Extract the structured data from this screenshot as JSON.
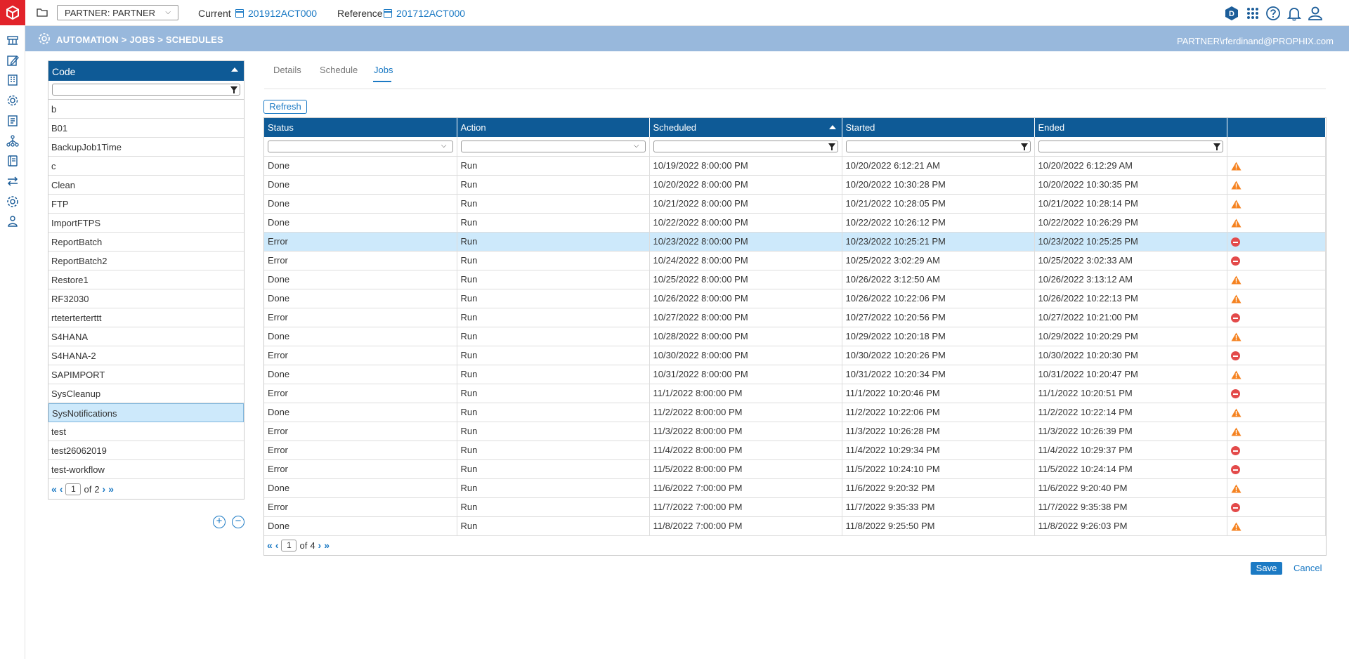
{
  "topbar": {
    "partner_select": "PARTNER: PARTNER",
    "current_label": "Current",
    "current_value": "201912ACT000",
    "reference_label": "Reference",
    "reference_value": "201712ACT000",
    "avatar_letter": "D",
    "icons": [
      "folder-icon",
      "apps-grid-icon",
      "help-icon",
      "bell-icon",
      "user-icon"
    ]
  },
  "rail": {
    "icons": [
      "logo-icon",
      "workflow-icon",
      "edit-document-icon",
      "org-chart-icon",
      "settings-gear-icon",
      "report-icon",
      "hierarchy-icon",
      "book-icon",
      "transfer-icon",
      "automation-gear-icon",
      "users-icon"
    ]
  },
  "breadcrumb": {
    "path": "AUTOMATION > JOBS > SCHEDULES",
    "user": "PARTNER\\rferdinand@PROPHIX.com"
  },
  "code_list": {
    "header": "Code",
    "items": [
      "b",
      "B01",
      "BackupJob1Time",
      "c",
      "Clean",
      "FTP",
      "ImportFTPS",
      "ReportBatch",
      "ReportBatch2",
      "Restore1",
      "RF32030",
      "rteterterterttt",
      "S4HANA",
      "S4HANA-2",
      "SAPIMPORT",
      "SysCleanup",
      "SysNotifications",
      "test",
      "test26062019",
      "test-workflow"
    ],
    "selected": "SysNotifications",
    "page": "1",
    "of_label": "of",
    "total_pages": "2"
  },
  "tabs": [
    {
      "label": "Details",
      "active": false
    },
    {
      "label": "Schedule",
      "active": false
    },
    {
      "label": "Jobs",
      "active": true
    }
  ],
  "refresh_label": "Refresh",
  "jobs_grid": {
    "columns": [
      "Status",
      "Action",
      "Scheduled",
      "Started",
      "Ended",
      ""
    ],
    "sorted_column": "Scheduled",
    "rows": [
      {
        "status": "Done",
        "action": "Run",
        "scheduled": "10/19/2022 8:00:00 PM",
        "started": "10/20/2022 6:12:21 AM",
        "ended": "10/20/2022 6:12:29 AM",
        "icon": "warning"
      },
      {
        "status": "Done",
        "action": "Run",
        "scheduled": "10/20/2022 8:00:00 PM",
        "started": "10/20/2022 10:30:28 PM",
        "ended": "10/20/2022 10:30:35 PM",
        "icon": "warning"
      },
      {
        "status": "Done",
        "action": "Run",
        "scheduled": "10/21/2022 8:00:00 PM",
        "started": "10/21/2022 10:28:05 PM",
        "ended": "10/21/2022 10:28:14 PM",
        "icon": "warning"
      },
      {
        "status": "Done",
        "action": "Run",
        "scheduled": "10/22/2022 8:00:00 PM",
        "started": "10/22/2022 10:26:12 PM",
        "ended": "10/22/2022 10:26:29 PM",
        "icon": "warning"
      },
      {
        "status": "Error",
        "action": "Run",
        "scheduled": "10/23/2022 8:00:00 PM",
        "started": "10/23/2022 10:25:21 PM",
        "ended": "10/23/2022 10:25:25 PM",
        "icon": "error",
        "highlight": true
      },
      {
        "status": "Error",
        "action": "Run",
        "scheduled": "10/24/2022 8:00:00 PM",
        "started": "10/25/2022 3:02:29 AM",
        "ended": "10/25/2022 3:02:33 AM",
        "icon": "error"
      },
      {
        "status": "Done",
        "action": "Run",
        "scheduled": "10/25/2022 8:00:00 PM",
        "started": "10/26/2022 3:12:50 AM",
        "ended": "10/26/2022 3:13:12 AM",
        "icon": "warning"
      },
      {
        "status": "Done",
        "action": "Run",
        "scheduled": "10/26/2022 8:00:00 PM",
        "started": "10/26/2022 10:22:06 PM",
        "ended": "10/26/2022 10:22:13 PM",
        "icon": "warning"
      },
      {
        "status": "Error",
        "action": "Run",
        "scheduled": "10/27/2022 8:00:00 PM",
        "started": "10/27/2022 10:20:56 PM",
        "ended": "10/27/2022 10:21:00 PM",
        "icon": "error"
      },
      {
        "status": "Done",
        "action": "Run",
        "scheduled": "10/28/2022 8:00:00 PM",
        "started": "10/29/2022 10:20:18 PM",
        "ended": "10/29/2022 10:20:29 PM",
        "icon": "warning"
      },
      {
        "status": "Error",
        "action": "Run",
        "scheduled": "10/30/2022 8:00:00 PM",
        "started": "10/30/2022 10:20:26 PM",
        "ended": "10/30/2022 10:20:30 PM",
        "icon": "error"
      },
      {
        "status": "Done",
        "action": "Run",
        "scheduled": "10/31/2022 8:00:00 PM",
        "started": "10/31/2022 10:20:34 PM",
        "ended": "10/31/2022 10:20:47 PM",
        "icon": "warning"
      },
      {
        "status": "Error",
        "action": "Run",
        "scheduled": "11/1/2022 8:00:00 PM",
        "started": "11/1/2022 10:20:46 PM",
        "ended": "11/1/2022 10:20:51 PM",
        "icon": "error"
      },
      {
        "status": "Done",
        "action": "Run",
        "scheduled": "11/2/2022 8:00:00 PM",
        "started": "11/2/2022 10:22:06 PM",
        "ended": "11/2/2022 10:22:14 PM",
        "icon": "warning"
      },
      {
        "status": "Error",
        "action": "Run",
        "scheduled": "11/3/2022 8:00:00 PM",
        "started": "11/3/2022 10:26:28 PM",
        "ended": "11/3/2022 10:26:39 PM",
        "icon": "warning"
      },
      {
        "status": "Error",
        "action": "Run",
        "scheduled": "11/4/2022 8:00:00 PM",
        "started": "11/4/2022 10:29:34 PM",
        "ended": "11/4/2022 10:29:37 PM",
        "icon": "error"
      },
      {
        "status": "Error",
        "action": "Run",
        "scheduled": "11/5/2022 8:00:00 PM",
        "started": "11/5/2022 10:24:10 PM",
        "ended": "11/5/2022 10:24:14 PM",
        "icon": "error"
      },
      {
        "status": "Done",
        "action": "Run",
        "scheduled": "11/6/2022 7:00:00 PM",
        "started": "11/6/2022 9:20:32 PM",
        "ended": "11/6/2022 9:20:40 PM",
        "icon": "warning"
      },
      {
        "status": "Error",
        "action": "Run",
        "scheduled": "11/7/2022 7:00:00 PM",
        "started": "11/7/2022 9:35:33 PM",
        "ended": "11/7/2022 9:35:38 PM",
        "icon": "error"
      },
      {
        "status": "Done",
        "action": "Run",
        "scheduled": "11/8/2022 7:00:00 PM",
        "started": "11/8/2022 9:25:50 PM",
        "ended": "11/8/2022 9:26:03 PM",
        "icon": "warning"
      }
    ],
    "page": "1",
    "of_label": "of",
    "total_pages": "4"
  },
  "colors": {
    "header_blue": "#0e5a96",
    "crumb_bar": "#98b8dc",
    "link_blue": "#1c7ac4",
    "warning_orange": "#f58220",
    "error_red": "#e34a4a",
    "selected_row": "#cde9fb",
    "logo_red": "#e2232a"
  },
  "footer": {
    "save_label": "Save",
    "cancel_label": "Cancel"
  }
}
